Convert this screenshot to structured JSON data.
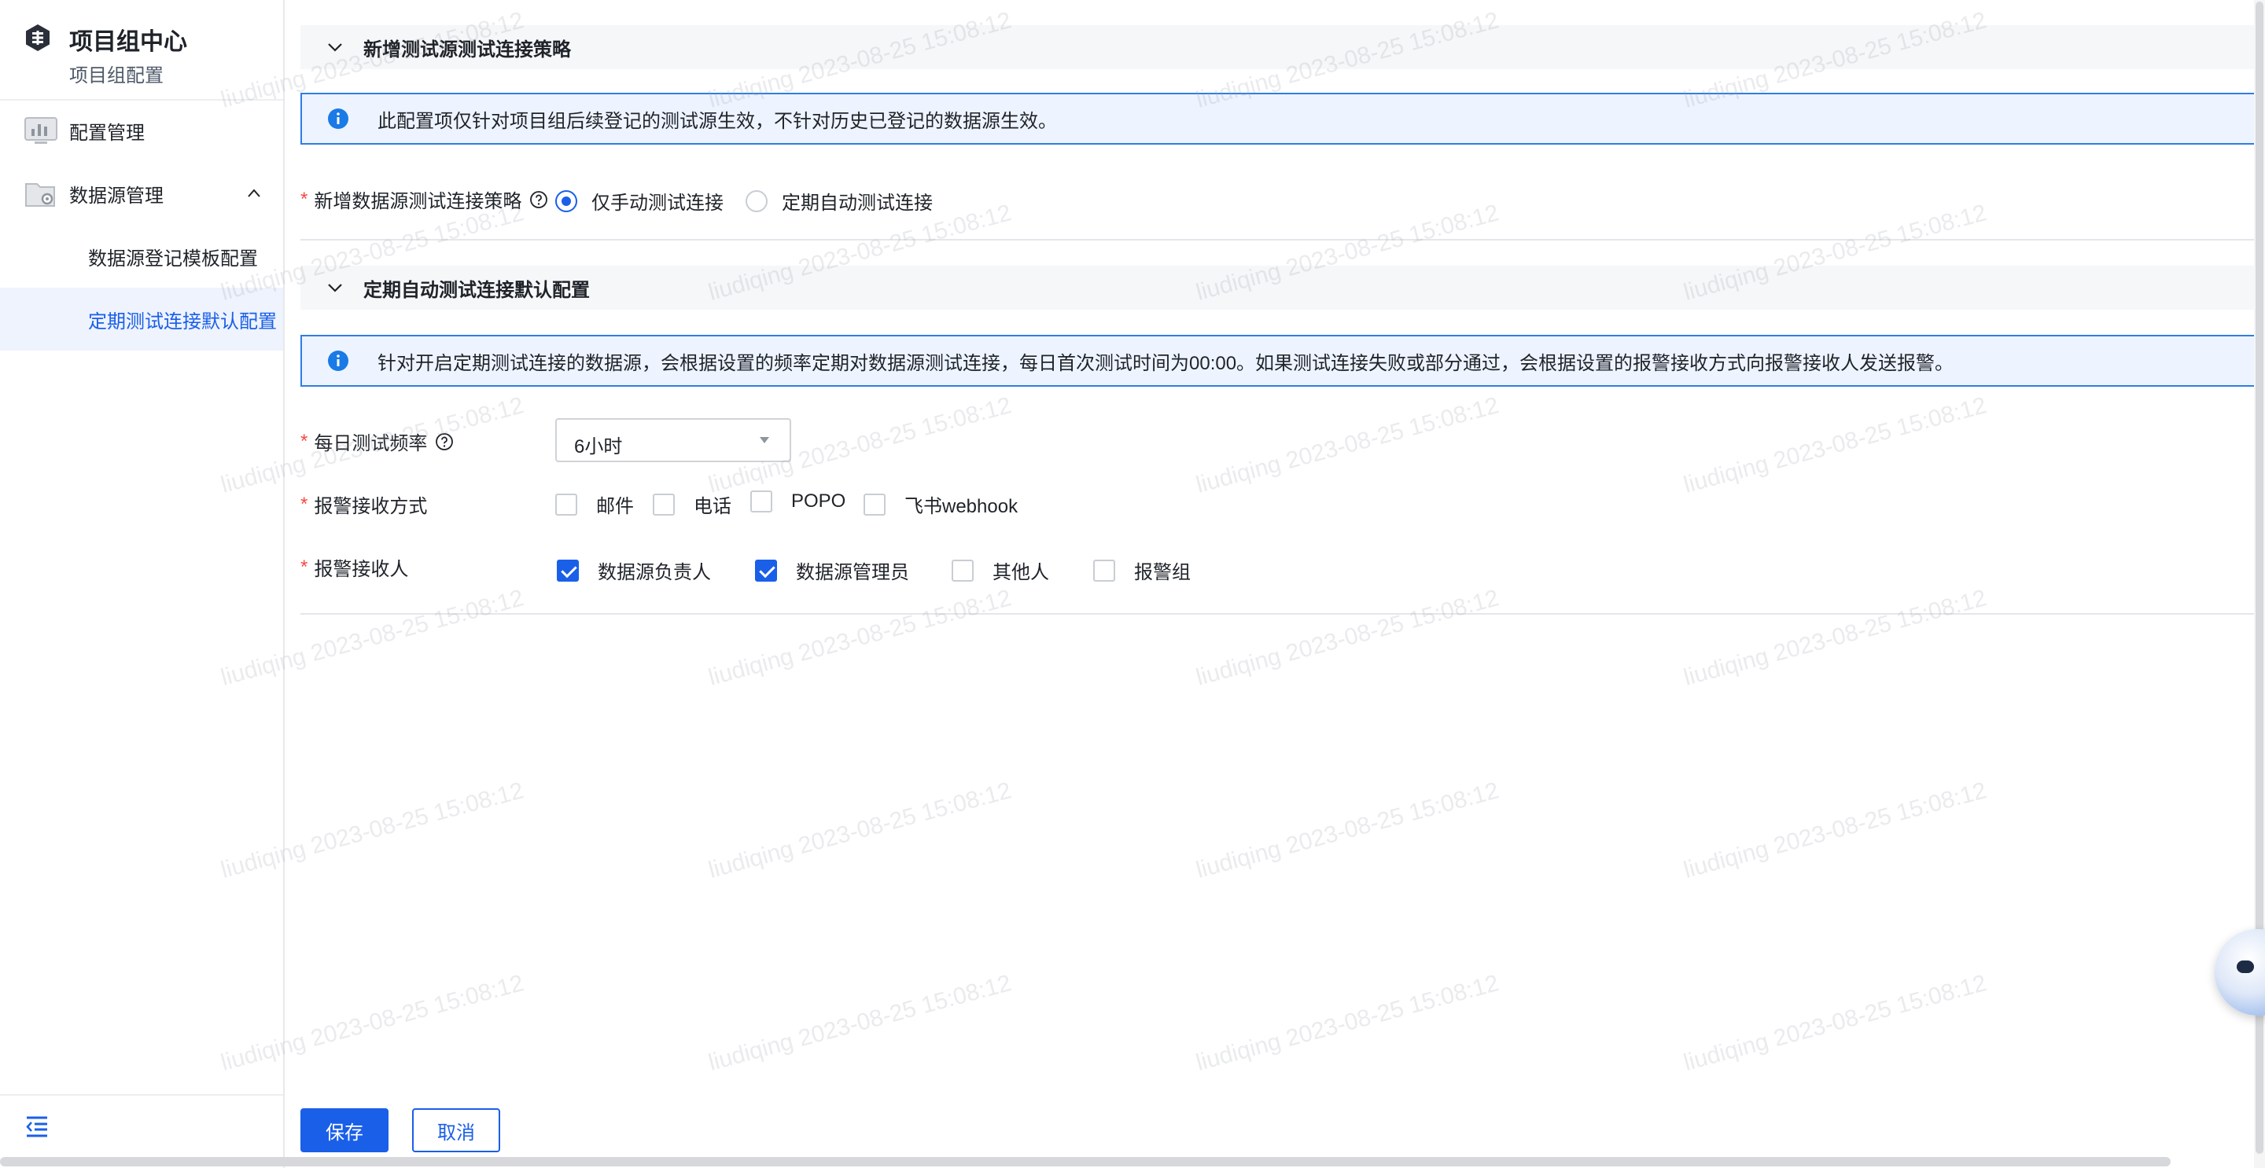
{
  "sidebar": {
    "title": "项目组中心",
    "subtitle": "项目组配置",
    "items": [
      {
        "label": "配置管理",
        "icon": "monitor-chart-icon"
      },
      {
        "label": "数据源管理",
        "icon": "database-gear-icon",
        "expanded": true
      }
    ],
    "sub_items": [
      {
        "label": "数据源登记模板配置",
        "active": false
      },
      {
        "label": "定期测试连接默认配置",
        "active": true
      }
    ]
  },
  "section1": {
    "title": "新增测试源测试连接策略",
    "info": "此配置项仅针对项目组后续登记的测试源生效，不针对历史已登记的数据源生效。",
    "strategy_label": "新增数据源测试连接策略",
    "options": [
      {
        "label": "仅手动测试连接",
        "selected": true
      },
      {
        "label": "定期自动测试连接",
        "selected": false
      }
    ]
  },
  "section2": {
    "title": "定期自动测试连接默认配置",
    "info": "针对开启定期测试连接的数据源，会根据设置的频率定期对数据源测试连接，每日首次测试时间为00:00。如果测试连接失败或部分通过，会根据设置的报警接收方式向报警接收人发送报警。",
    "frequency_label": "每日测试频率",
    "frequency_value": "6小时",
    "alert_method_label": "报警接收方式",
    "alert_methods": [
      {
        "label": "邮件",
        "checked": false
      },
      {
        "label": "电话",
        "checked": false
      },
      {
        "label": "POPO",
        "checked": false
      },
      {
        "label": "飞书webhook",
        "checked": false
      }
    ],
    "receiver_label": "报警接收人",
    "receivers": [
      {
        "label": "数据源负责人",
        "checked": true
      },
      {
        "label": "数据源管理员",
        "checked": true
      },
      {
        "label": "其他人",
        "checked": false
      },
      {
        "label": "报警组",
        "checked": false
      }
    ]
  },
  "actions": {
    "save_label": "保存",
    "cancel_label": "取消"
  },
  "required_mark": "*",
  "watermark_text": "liudiqing 2023-08-25 15:08:12",
  "colors": {
    "primary": "#1a5fe8",
    "info_bg": "#edf4ff",
    "info_border": "#2f7de6",
    "required": "#f54a45",
    "section_bg": "#f6f7f9"
  }
}
